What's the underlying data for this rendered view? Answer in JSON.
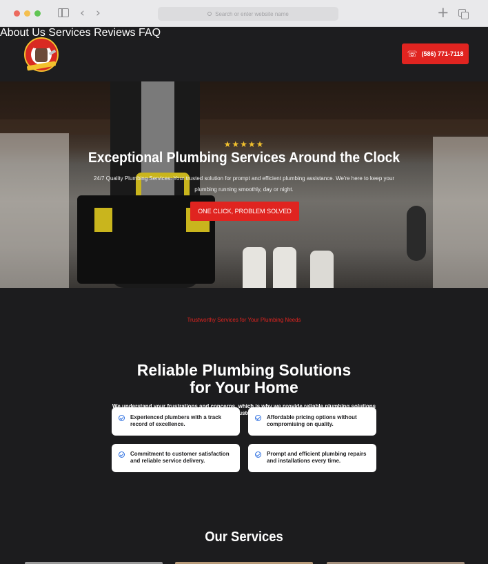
{
  "browser": {
    "address_placeholder": "Search or enter website name",
    "back_icon": "‹",
    "forward_icon": "›",
    "new_tab_icon": "+"
  },
  "header": {
    "nav": [
      "About Us",
      "Services",
      "Reviews",
      "FAQ"
    ],
    "phone": "(586) 771-7118",
    "phone_icon": "☏"
  },
  "hero": {
    "stars": "★★★★★",
    "title": "Exceptional Plumbing Services Around the Clock",
    "subtitle": "24/7 Quality Plumbing Services: Your trusted solution for prompt and efficient plumbing assistance. We're here to keep your plumbing running smoothly, day or night.",
    "cta": "ONE CLICK, PROBLEM SOLVED"
  },
  "solutions": {
    "kicker": "Trustworthy Services for Your Plumbing Needs",
    "title_line1": "Reliable Plumbing Solutions",
    "title_line2": "for Your Home",
    "description": "We understand your frustrations and concerns, which is why we provide reliable plumbing solutions with a focus on customer satisfaction.",
    "cards": [
      "Experienced plumbers with a track record of excellence.",
      "Affordable pricing options without compromising on quality.",
      "Commitment to customer satisfaction and reliable service delivery.",
      "Prompt and efficient plumbing repairs and installations every time."
    ]
  },
  "services": {
    "title": "Our Services"
  },
  "colors": {
    "accent": "#e02420",
    "background": "#1c1c1e",
    "star": "#f2c12e",
    "check": "#2a6de0"
  }
}
